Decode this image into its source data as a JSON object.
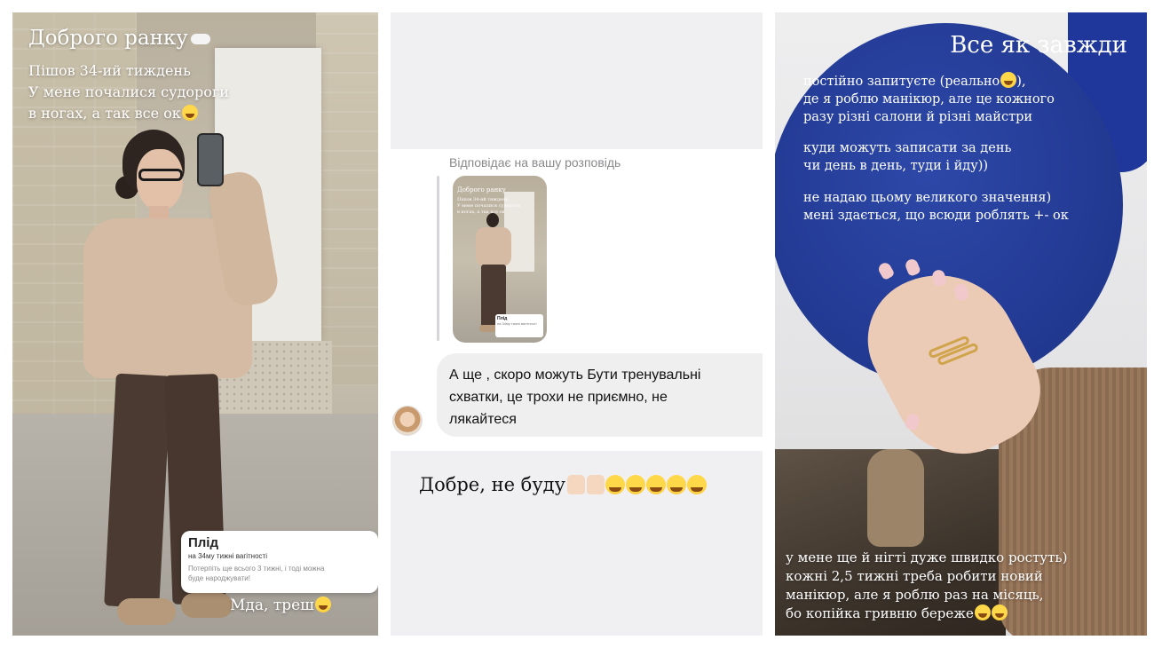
{
  "panel1": {
    "title": "Доброго ранку",
    "title_icon": "cloud-icon",
    "lines": [
      "Пішов 34-ий тиждень",
      "У мене почалися судороги",
      "в ногах, а так все ок"
    ],
    "line_emoji": "laughing-emoji",
    "sticker": {
      "title": "Плід",
      "subtitle": "на 34му тижні вагітності",
      "description_1": "Потерпіть ще всього 3 тижні, і тоді можна",
      "description_2": "буде народжувати!"
    },
    "footer": "Мда, треш",
    "footer_emoji": "laughing-emoji"
  },
  "panel2": {
    "reply_label": "Відповідає на вашу розповідь",
    "thumbnail": {
      "title": "Доброго ранку",
      "lines": [
        "Пішов 34-ий тиждень",
        "У мене почалися судороги",
        "в ногах, а так все ок"
      ],
      "sticker_title": "Плід",
      "sticker_subtitle": "на 34му тижні вагітності"
    },
    "message_lines": [
      "А ще , скоро можуть Бути тренувальні",
      "схватки, це трохи не приємно, не",
      "лякайтеся"
    ],
    "reaction_text": "Добре, не буду",
    "reaction_emojis": [
      "thumbs-up",
      "thumbs-up",
      "salute-face",
      "crying-face",
      "sobbing-face",
      "laughing-face",
      "laughing-face"
    ]
  },
  "panel3": {
    "title": "Все як завжди",
    "block1": [
      "постійно запитуєте (реально",
      "де я роблю манікюр, але це кожного",
      "разу різні салони й різні майстри"
    ],
    "block1_suffix": "),",
    "block2": [
      "куди можуть записати за день",
      "чи день в день, туди і йду))"
    ],
    "block3": [
      "не надаю цьому великого значення)",
      "мені здається, що всюди роблять +- ок"
    ],
    "bottom": [
      "у мене ще й нігті дуже швидко ростуть)",
      "кожні 2,5 тижні треба робити новий",
      "манікюр, але я роблю раз на місяць,",
      "бо копійка гривню береже"
    ]
  }
}
